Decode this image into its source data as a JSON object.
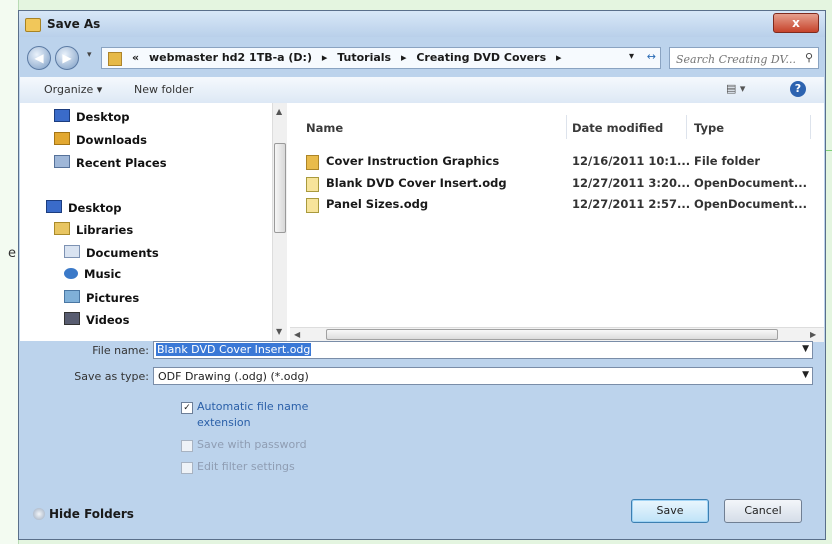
{
  "background": {
    "partial_char": "e"
  },
  "window": {
    "title": "Save As",
    "close_label": "x"
  },
  "address": {
    "crumbs": [
      "«",
      "webmaster hd2 1TB-a (D:)",
      "▸",
      "Tutorials",
      "▸",
      "Creating DVD Covers",
      "▸"
    ],
    "search_placeholder": "Search Creating DV..."
  },
  "toolbar": {
    "organize": "Organize ▾",
    "new_folder": "New folder"
  },
  "nav": {
    "favorites": [
      "Desktop",
      "Downloads",
      "Recent Places"
    ],
    "desktop": "Desktop",
    "libraries": "Libraries",
    "library_items": [
      "Documents",
      "Music",
      "Pictures",
      "Videos"
    ]
  },
  "columns": {
    "name": "Name",
    "date": "Date modified",
    "type": "Type"
  },
  "files": [
    {
      "name": "Cover Instruction Graphics",
      "date": "12/16/2011 10:1...",
      "type": "File folder",
      "icon": "folder-icon"
    },
    {
      "name": "Blank DVD Cover Insert.odg",
      "date": "12/27/2011 3:20...",
      "type": "OpenDocument...",
      "icon": "odg-file-icon"
    },
    {
      "name": "Panel Sizes.odg",
      "date": "12/27/2011 2:57...",
      "type": "OpenDocument...",
      "icon": "odg-file-icon"
    }
  ],
  "form": {
    "file_name_label": "File name:",
    "file_name_value": "Blank DVD Cover Insert.odg",
    "save_type_label": "Save as type:",
    "save_type_value": "ODF Drawing (.odg) (*.odg)"
  },
  "options": {
    "auto_ext_line1": "Automatic file name",
    "auto_ext_line2": "extension",
    "auto_ext_checked": true,
    "password": "Save with password",
    "filter": "Edit filter settings"
  },
  "footer": {
    "hide_folders": "Hide Folders",
    "save": "Save",
    "cancel": "Cancel"
  }
}
